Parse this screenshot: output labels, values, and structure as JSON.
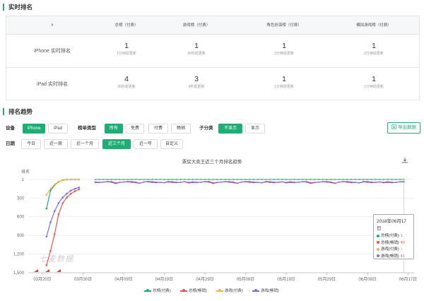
{
  "realtime": {
    "title": "实时排名",
    "headers": [
      "#",
      "总榜（付费）",
      "游戏榜（付费）",
      "角色扮演榜（付费）",
      "模拟游戏榜（付费）"
    ],
    "rows": [
      {
        "label": "iPhone 实时排名",
        "cells": [
          {
            "rank": "1",
            "time": "1分钟前更新"
          },
          {
            "rank": "1",
            "time": "36秒前更新"
          },
          {
            "rank": "1",
            "time": "2分钟前更新"
          },
          {
            "rank": "1",
            "time": "2分钟前更新"
          }
        ]
      },
      {
        "label": "iPad 实时排名",
        "cells": [
          {
            "rank": "4",
            "time": "36秒前更新"
          },
          {
            "rank": "3",
            "time": "9秒前更新"
          },
          {
            "rank": "1",
            "time": "1分钟前更新"
          },
          {
            "rank": "1",
            "time": "1分钟前更新"
          }
        ]
      }
    ]
  },
  "trend": {
    "title": "排名趋势",
    "device_label": "设备",
    "devices": [
      "iPhone",
      "iPad"
    ],
    "list_type_label": "榜单类型",
    "list_types": [
      "所有",
      "免费",
      "付费",
      "畅销"
    ],
    "subcat_label": "子分类",
    "subcats": [
      "不显示",
      "显示"
    ],
    "date_label": "日期",
    "dates": [
      "今日",
      "近一周",
      "近一个月",
      "近三个月",
      "近一年",
      "自定义"
    ],
    "export_label": "导出数据"
  },
  "chart_data": {
    "type": "line",
    "title": "票房大卖王近三个月排名趋势",
    "ylabel": "排名",
    "y_ticks": [
      "1",
      "300",
      "600",
      "900",
      "1,200",
      "1,500"
    ],
    "ylim": [
      1,
      1500
    ],
    "y_inverted": true,
    "x_ticks": [
      "03月20日",
      "03月30日",
      "04月09日",
      "04月19日",
      "04月29日",
      "05月09日",
      "05月19日",
      "05月29日",
      "06月08日",
      "06月17日"
    ],
    "series": [
      {
        "name": "总榜(付费)",
        "color": "#1fad75",
        "x": [
          1,
          2,
          3,
          4,
          5,
          6,
          7,
          8,
          9
        ],
        "values": [
          470,
          180,
          90,
          40,
          10,
          2,
          1,
          1,
          1
        ]
      },
      {
        "name": "总榜(畅销)",
        "color": "#e8574a",
        "x": [
          1,
          2,
          3,
          4,
          5,
          6,
          7,
          8,
          9
        ],
        "values": [
          1380,
          1150,
          880,
          560,
          380,
          290,
          230,
          190,
          160
        ]
      },
      {
        "name": "游戏(付费)",
        "color": "#f1b44d",
        "x": [
          1,
          2,
          3,
          4,
          5,
          6,
          7,
          8,
          9
        ],
        "values": [
          250,
          150,
          80,
          35,
          15,
          3,
          1,
          1,
          1
        ]
      },
      {
        "name": "游戏(畅销)",
        "color": "#7b6ee0",
        "x": [
          1,
          2,
          3,
          4,
          5,
          6,
          7,
          8,
          9
        ],
        "values": [
          920,
          690,
          510,
          380,
          290,
          230,
          180,
          150,
          130
        ]
      }
    ],
    "tooltip": {
      "date": "2018年06月17日",
      "items": [
        {
          "name": "总榜(付费)",
          "value": "1"
        },
        {
          "name": "总榜(畅销)",
          "value": "49"
        },
        {
          "name": "游戏(付费)",
          "value": "1"
        },
        {
          "name": "游戏(畅销)",
          "value": "41"
        }
      ]
    },
    "legend_position": "bottom"
  },
  "watermark": "七麦数据"
}
